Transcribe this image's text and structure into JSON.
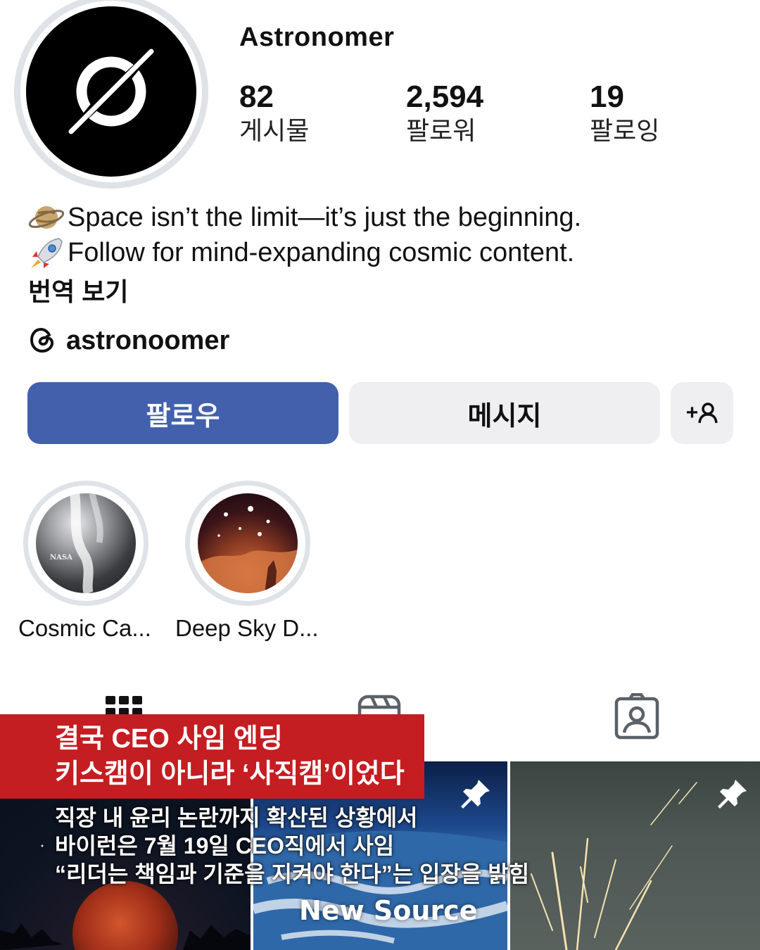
{
  "profile": {
    "username": "Astronomer",
    "stats": [
      {
        "value": "82",
        "label": "게시물"
      },
      {
        "value": "2,594",
        "label": "팔로워"
      },
      {
        "value": "19",
        "label": "팔로잉"
      }
    ],
    "bio": {
      "line1": "Space isn’t the limit—it’s just the beginning.",
      "line1_icon": "ringed-planet-emoji",
      "line2": "Follow for mind-expanding cosmic content.",
      "line2_icon": "rocket-emoji",
      "translate_link": "번역 보기"
    },
    "threads_handle": "astronoomer"
  },
  "actions": {
    "follow": "팔로우",
    "message": "메시지",
    "add_person": "+"
  },
  "highlights": [
    {
      "label": "Cosmic Ca...",
      "thumb_text": "NASA"
    },
    {
      "label": "Deep Sky D..."
    }
  ],
  "tabs": [
    {
      "name": "posts-grid",
      "icon": "grid-icon"
    },
    {
      "name": "reels",
      "icon": "reels-icon"
    },
    {
      "name": "tagged",
      "icon": "tagged-person-icon"
    }
  ],
  "news_overlay": {
    "headline_line1": "결국 CEO 사임 엔딩",
    "headline_line2": "키스캠이 아니라 ‘사직캠’이었다",
    "body_line1": "직장 내 윤리 논란까지 확산된 상황에서",
    "body_line2": "바이런은 7월 19일  CEO직에서 사임",
    "body_line3": "“리더는 책임과 기준을 지켜야 한다”는 입장을 밝힘",
    "source": "New Source",
    "accent_color": "#c41d22"
  }
}
